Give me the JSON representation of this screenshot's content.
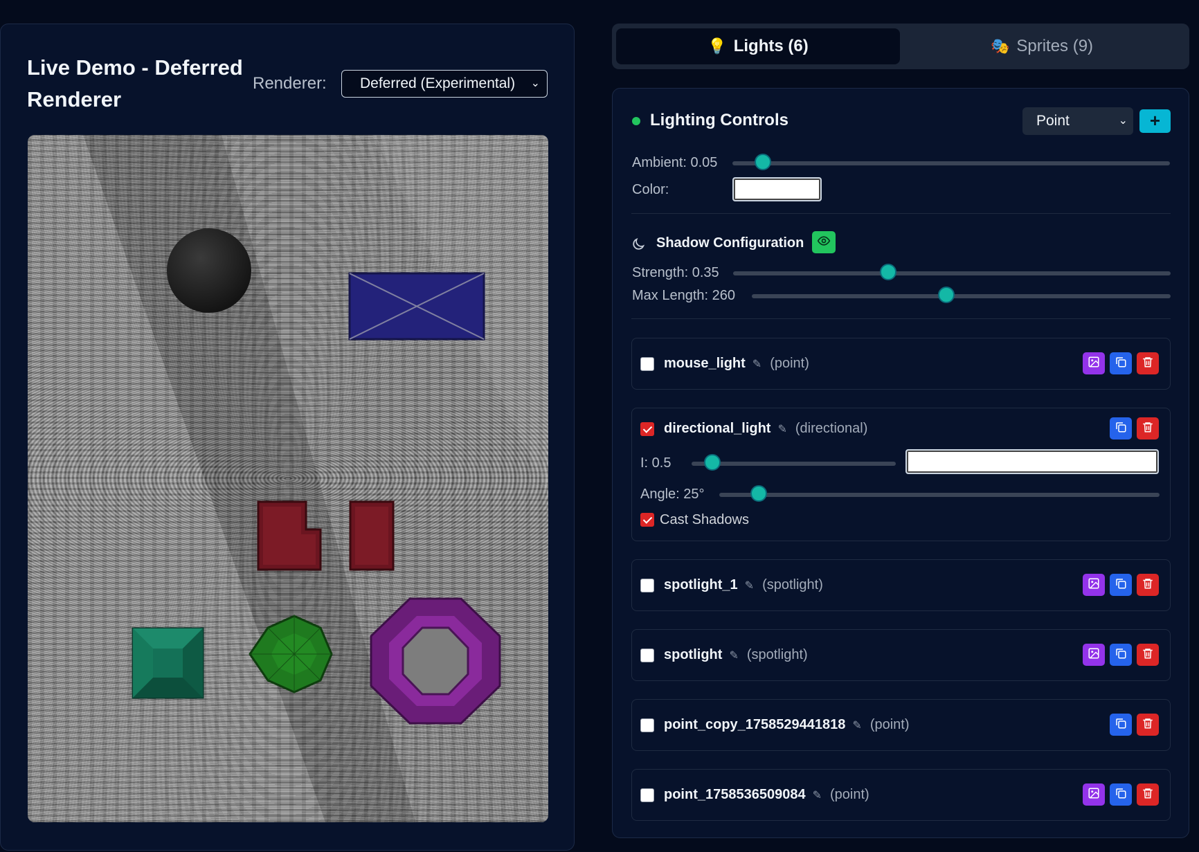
{
  "demo": {
    "title": "Live Demo - Deferred Renderer",
    "renderer_label": "Renderer:",
    "renderer_value": "Deferred (Experimental)"
  },
  "tabs": [
    {
      "label": "Lights (6)",
      "icon": "lightbulb-icon",
      "active": true
    },
    {
      "label": "Sprites (9)",
      "icon": "theater-masks-icon",
      "active": false
    }
  ],
  "lighting": {
    "title": "Lighting Controls",
    "light_type": "Point",
    "add_label": "+",
    "ambient_label": "Ambient: 0.05",
    "ambient_value": 0.05,
    "color_label": "Color:",
    "ambient_color": "#ffffff"
  },
  "shadow": {
    "title": "Shadow Configuration",
    "strength_label": "Strength: 0.35",
    "strength_value": 0.35,
    "max_length_label": "Max Length: 260",
    "max_length_value": 260
  },
  "lights": [
    {
      "name": "mouse_light",
      "type": "(point)",
      "enabled": false,
      "buttons": [
        "image",
        "copy",
        "delete"
      ]
    },
    {
      "name": "directional_light",
      "type": "(directional)",
      "enabled": true,
      "buttons": [
        "copy",
        "delete"
      ],
      "intensity_label": "I: 0.5",
      "intensity": 0.5,
      "color": "#ffffff",
      "angle_label": "Angle: 25°",
      "angle": 25,
      "cast_shadows_label": "Cast Shadows",
      "cast_shadows": true
    },
    {
      "name": "spotlight_1",
      "type": "(spotlight)",
      "enabled": false,
      "buttons": [
        "image",
        "copy",
        "delete"
      ]
    },
    {
      "name": "spotlight",
      "type": "(spotlight)",
      "enabled": false,
      "buttons": [
        "image",
        "copy",
        "delete"
      ]
    },
    {
      "name": "point_copy_1758529441818",
      "type": "(point)",
      "enabled": false,
      "buttons": [
        "copy",
        "delete"
      ]
    },
    {
      "name": "point_1758536509084",
      "type": "(point)",
      "enabled": false,
      "buttons": [
        "image",
        "copy",
        "delete"
      ]
    }
  ],
  "colors": {
    "accent": "#06b6d4",
    "thumb": "#14b8a6",
    "status": "#22c55e",
    "image_button": "#9333ea",
    "copy_button": "#2563eb",
    "delete_button": "#dc2626"
  }
}
